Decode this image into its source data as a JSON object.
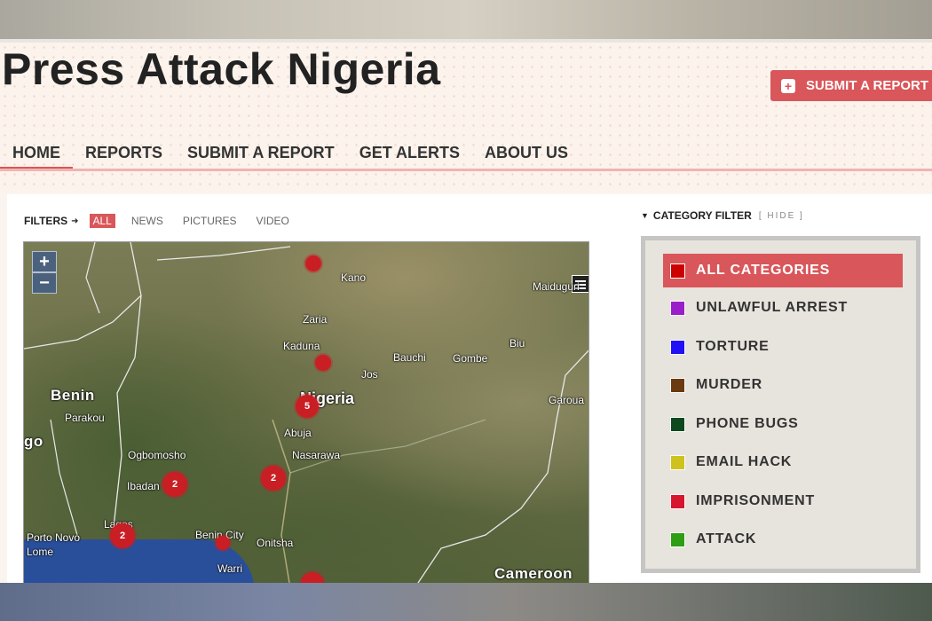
{
  "site": {
    "title": "Press Attack Nigeria",
    "submit_button_label": "SUBMIT A REPORT",
    "submit_icon": "plus-icon"
  },
  "nav": {
    "items": [
      {
        "label": "HOME",
        "active": true
      },
      {
        "label": "REPORTS",
        "active": false
      },
      {
        "label": "SUBMIT A REPORT",
        "active": false
      },
      {
        "label": "GET ALERTS",
        "active": false
      },
      {
        "label": "ABOUT US",
        "active": false
      }
    ]
  },
  "filters": {
    "label": "FILTERS",
    "tabs": [
      {
        "label": "ALL",
        "active": true
      },
      {
        "label": "NEWS",
        "active": false
      },
      {
        "label": "PICTURES",
        "active": false
      },
      {
        "label": "VIDEO",
        "active": false
      }
    ]
  },
  "map": {
    "zoom_in": "+",
    "zoom_out": "−",
    "cities": [
      "Kano",
      "Maiduguri",
      "Zaria",
      "Kaduna",
      "Bauchi",
      "Gombe",
      "Biu",
      "Jos",
      "Nigeria",
      "Benin",
      "Parakou",
      "Abuja",
      "Garoua",
      "Ogbomosho",
      "Nasarawa",
      "Ibadan",
      "Lagos",
      "Porto Novo",
      "Lome",
      "Benin City",
      "Onitsha",
      "Warri",
      "Cameroon",
      "go"
    ],
    "clusters": [
      "",
      "",
      "5",
      "2",
      "2",
      "2",
      "",
      ""
    ]
  },
  "category_filter": {
    "label": "CATEGORY FILTER",
    "hide_label": "[ HIDE ]",
    "items": [
      {
        "label": "ALL CATEGORIES",
        "color": "#cc0000",
        "active": true
      },
      {
        "label": "UNLAWFUL ARREST",
        "color": "#9b1fc9",
        "active": false
      },
      {
        "label": "TORTURE",
        "color": "#2211f5",
        "active": false
      },
      {
        "label": "MURDER",
        "color": "#6b3a10",
        "active": false
      },
      {
        "label": "PHONE BUGS",
        "color": "#0e4a1e",
        "active": false
      },
      {
        "label": "EMAIL HACK",
        "color": "#cfc21c",
        "active": false
      },
      {
        "label": "IMPRISONMENT",
        "color": "#d8172e",
        "active": false
      },
      {
        "label": "ATTACK",
        "color": "#2e9e14",
        "active": false
      }
    ]
  }
}
